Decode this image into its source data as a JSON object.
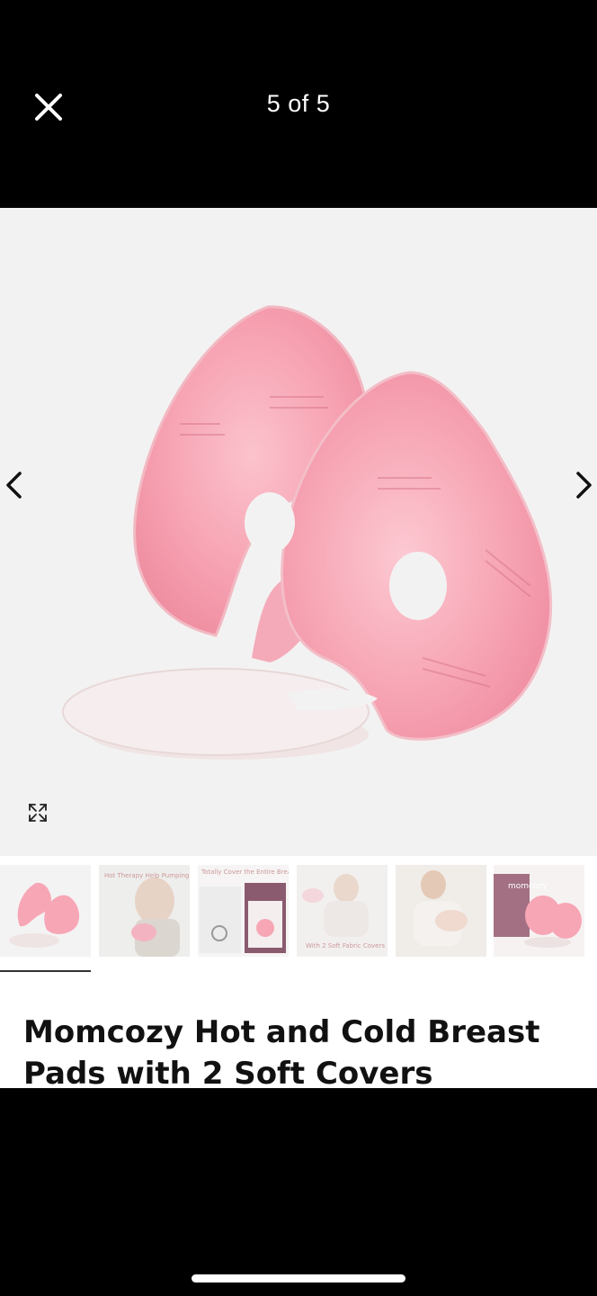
{
  "status": {
    "indicator_color": "#f6c500"
  },
  "header": {
    "close_icon": "close-icon",
    "counter": "5 of 5"
  },
  "gallery": {
    "prev_icon": "chevron-left-icon",
    "next_icon": "chevron-right-icon",
    "expand_icon": "expand-icon",
    "thumbnails": [
      {
        "name": "pads-and-covers",
        "selected": true
      },
      {
        "name": "hot-therapy-pumping",
        "caption": "Hot Therapy\nHelp Pumping",
        "selected": false
      },
      {
        "name": "totally-cover-breast",
        "caption": "Totally Cover the Entire Breast",
        "selected": false
      },
      {
        "name": "soft-fabric-covers",
        "caption": "With 2 Soft Fabric Covers",
        "selected": false
      },
      {
        "name": "mother-with-baby",
        "selected": false
      },
      {
        "name": "momcozy-package",
        "caption": "momcozy",
        "selected": false
      }
    ]
  },
  "product": {
    "title": "Momcozy Hot and Cold Breast Pads with 2 Soft Covers"
  },
  "colors": {
    "background": "#000000",
    "content_bg": "#ffffff",
    "pad_pink": "#f7a6b5"
  }
}
